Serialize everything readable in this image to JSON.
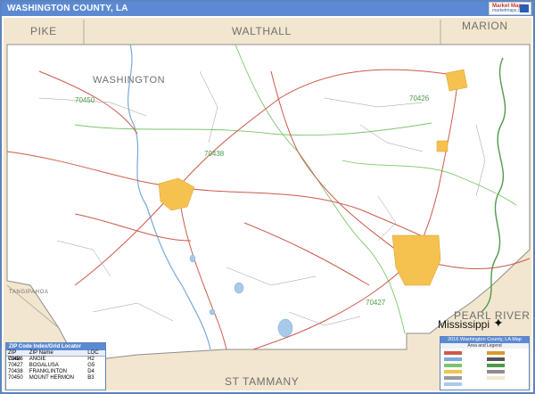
{
  "title": "WASHINGTON COUNTY, LA",
  "logo": {
    "line1": "Market Maps",
    "line2": "marketmaps.com"
  },
  "labels": {
    "county_main": "WASHINGTON",
    "pike": "PIKE",
    "walthall": "WALTHALL",
    "marion": "MARION",
    "tangipahoa": "TANGIPAHOA",
    "st_tammany": "ST TAMMANY",
    "pearl_river": "PEARL RIVER",
    "mississippi": "Mississippi"
  },
  "zip_labels": [
    "70450",
    "70426",
    "70438",
    "70427"
  ],
  "zip_table": {
    "title": "ZIP Code Index/Grid Locator",
    "columns": [
      "ZIP Code",
      "ZIP Name",
      "LOC"
    ],
    "rows": [
      [
        "70426",
        "ANGIE",
        "H2"
      ],
      [
        "70427",
        "BOGALUSA",
        "G5"
      ],
      [
        "70438",
        "FRANKLINTON",
        "D4"
      ],
      [
        "70450",
        "MOUNT HERMON",
        "B3"
      ]
    ]
  },
  "legend": {
    "title": "2016 Washington County, LA Map",
    "subtitle": "Area and Legend"
  },
  "colors": {
    "title_bar": "#5c8ad2",
    "map_bg": "#f3e6cf",
    "county_fill": "#ffffff",
    "roads": "#cc5a4b",
    "rivers": "#7aa9d9",
    "zip_bounds": "#7bc56b",
    "towns": "#f5c24f"
  }
}
